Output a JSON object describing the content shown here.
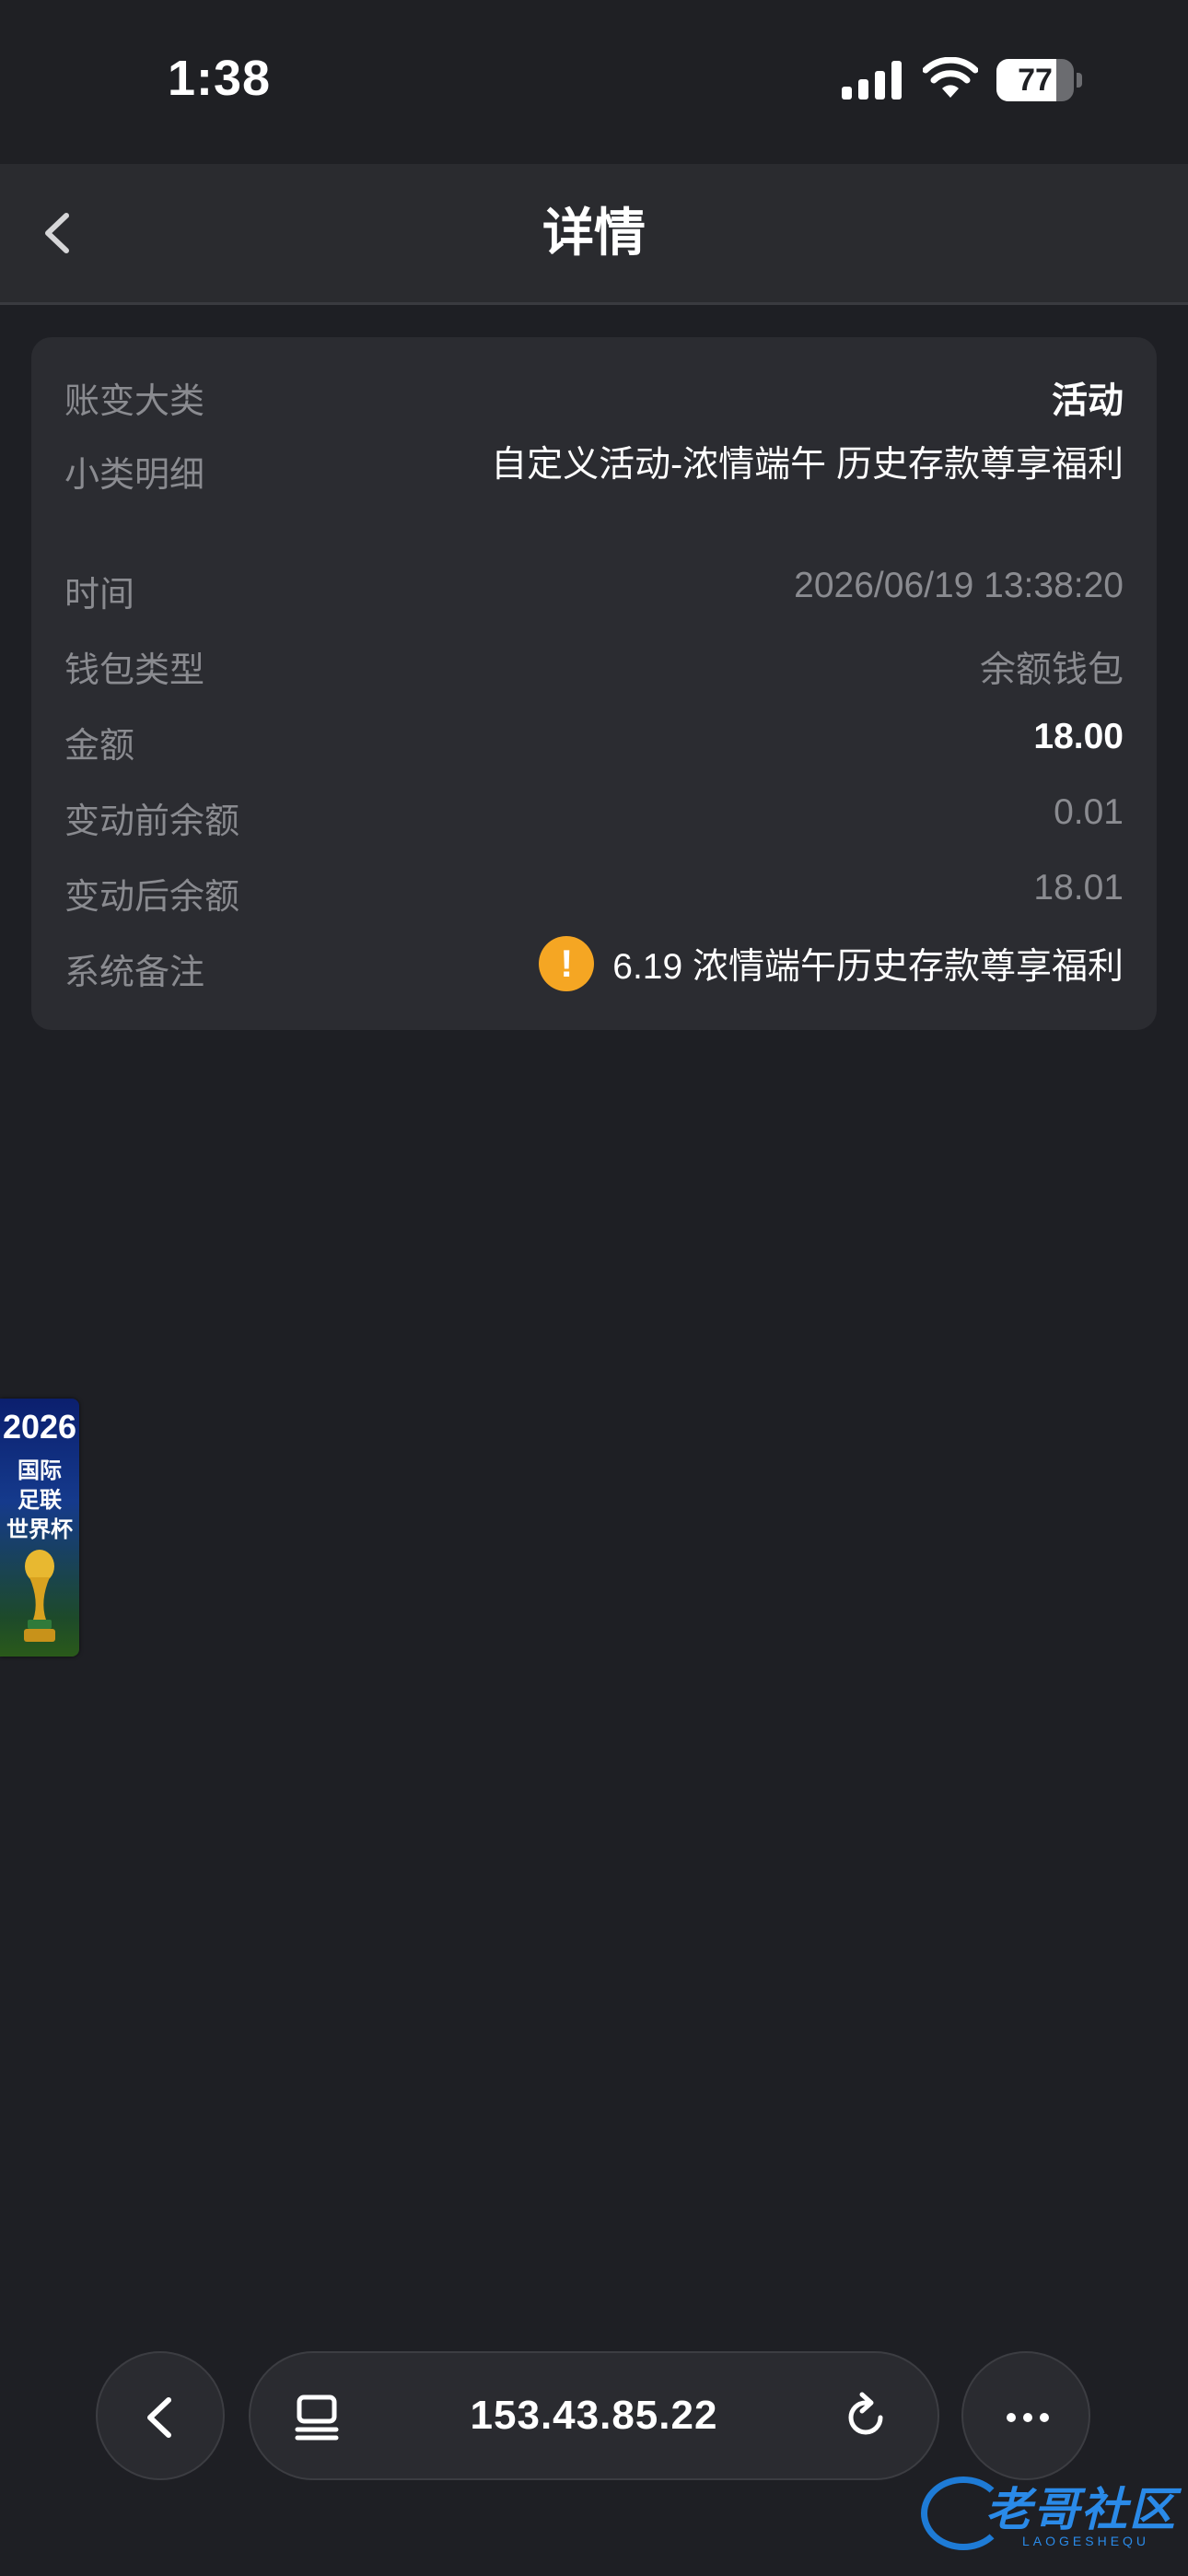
{
  "status_bar": {
    "time": "1:38",
    "battery_level": "77",
    "battery_percent": 77,
    "icons": [
      "signal-icon",
      "wifi-icon",
      "battery-icon"
    ]
  },
  "header": {
    "title": "详情",
    "back_icon": "chevron-left-icon"
  },
  "detail": {
    "rows": [
      {
        "label": "账变大类",
        "value": "活动"
      },
      {
        "label": "小类明细",
        "value": "自定义活动-浓情端午 历史存款尊享福利"
      },
      {
        "label": "时间",
        "value": "2026/06/19 13:38:20"
      },
      {
        "label": "钱包类型",
        "value": "余额钱包"
      },
      {
        "label": "金额",
        "value": "18.00"
      },
      {
        "label": "变动前余额",
        "value": "0.01"
      },
      {
        "label": "变动后余额",
        "value": "18.01"
      },
      {
        "label": "系统备注",
        "value": "6.19 浓情端午历史存款尊享福利"
      }
    ],
    "remark_icon": "alert-icon",
    "remark_icon_glyph": "!",
    "accent_color": "#f5a623"
  },
  "promo": {
    "year": "2026",
    "lines": [
      "国际",
      "足联",
      "世界杯"
    ],
    "icon": "trophy-icon"
  },
  "browser_bar": {
    "url": "153.43.85.22",
    "icons": [
      "back-icon",
      "tabs-icon",
      "reload-icon",
      "more-icon"
    ]
  },
  "watermark": {
    "text": "老哥社区",
    "sub": "LAOGESHEQU"
  }
}
